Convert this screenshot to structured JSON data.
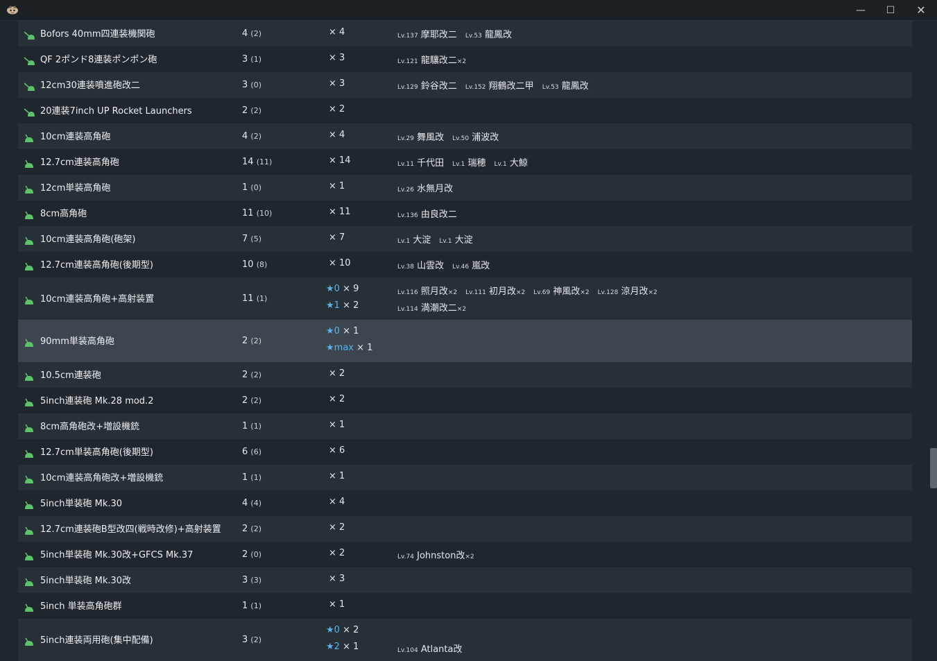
{
  "window": {
    "icon": "app-logo-icon",
    "minimize_glyph": "—",
    "maximize_glyph": "☐",
    "close_glyph": "✕"
  },
  "colors": {
    "star": "#5ab4ef",
    "icon_green": "#5cc36a",
    "row_alt": "#273036",
    "row_selected": "#3d464e"
  },
  "rows": [
    {
      "name": "Bofors 40mm四連装機関砲",
      "icon": "machine-gun-icon",
      "count": "4",
      "count_sub": "(2)",
      "mult": [
        "× 4"
      ],
      "ships": [
        [
          {
            "lv": "Lv.137",
            "name": "摩耶改二",
            "x": ""
          },
          {
            "lv": "Lv.53",
            "name": "龍鳳改",
            "x": ""
          }
        ]
      ]
    },
    {
      "name": "QF 2ポンド8連装ポンポン砲",
      "icon": "machine-gun-icon",
      "count": "3",
      "count_sub": "(1)",
      "mult": [
        "× 3"
      ],
      "ships": [
        [
          {
            "lv": "Lv.121",
            "name": "龍驤改二",
            "x": "×2"
          }
        ]
      ]
    },
    {
      "name": "12cm30連装噴進砲改二",
      "icon": "machine-gun-icon",
      "count": "3",
      "count_sub": "(0)",
      "mult": [
        "× 3"
      ],
      "ships": [
        [
          {
            "lv": "Lv.129",
            "name": "鈴谷改二",
            "x": ""
          },
          {
            "lv": "Lv.152",
            "name": "翔鶴改二甲",
            "x": ""
          },
          {
            "lv": "Lv.53",
            "name": "龍鳳改",
            "x": ""
          }
        ]
      ]
    },
    {
      "name": "20連装7inch UP Rocket Launchers",
      "icon": "machine-gun-icon",
      "count": "2",
      "count_sub": "(2)",
      "mult": [
        "× 2"
      ],
      "ships": []
    },
    {
      "name": "10cm連装高角砲",
      "icon": "aa-gun-icon",
      "count": "4",
      "count_sub": "(2)",
      "mult": [
        "× 4"
      ],
      "ships": [
        [
          {
            "lv": "Lv.29",
            "name": "舞風改",
            "x": ""
          },
          {
            "lv": "Lv.50",
            "name": "浦波改",
            "x": ""
          }
        ]
      ]
    },
    {
      "name": "12.7cm連装高角砲",
      "icon": "aa-gun-icon",
      "count": "14",
      "count_sub": "(11)",
      "mult": [
        "× 14"
      ],
      "ships": [
        [
          {
            "lv": "Lv.11",
            "name": "千代田",
            "x": ""
          },
          {
            "lv": "Lv.1",
            "name": "瑞穂",
            "x": ""
          },
          {
            "lv": "Lv.1",
            "name": "大鯨",
            "x": ""
          }
        ]
      ]
    },
    {
      "name": "12cm単装高角砲",
      "icon": "aa-gun-icon",
      "count": "1",
      "count_sub": "(0)",
      "mult": [
        "× 1"
      ],
      "ships": [
        [
          {
            "lv": "Lv.26",
            "name": "水無月改",
            "x": ""
          }
        ]
      ]
    },
    {
      "name": "8cm高角砲",
      "icon": "aa-gun-icon",
      "count": "11",
      "count_sub": "(10)",
      "mult": [
        "× 11"
      ],
      "ships": [
        [
          {
            "lv": "Lv.136",
            "name": "由良改二",
            "x": ""
          }
        ]
      ]
    },
    {
      "name": "10cm連装高角砲(砲架)",
      "icon": "aa-gun-icon",
      "count": "7",
      "count_sub": "(5)",
      "mult": [
        "× 7"
      ],
      "ships": [
        [
          {
            "lv": "Lv.1",
            "name": "大淀",
            "x": ""
          },
          {
            "lv": "Lv.1",
            "name": "大淀",
            "x": ""
          }
        ]
      ]
    },
    {
      "name": "12.7cm連装高角砲(後期型)",
      "icon": "aa-gun-icon",
      "count": "10",
      "count_sub": "(8)",
      "mult": [
        "× 10"
      ],
      "ships": [
        [
          {
            "lv": "Lv.38",
            "name": "山雲改",
            "x": ""
          },
          {
            "lv": "Lv.46",
            "name": "嵐改",
            "x": ""
          }
        ]
      ]
    },
    {
      "name": "10cm連装高角砲+高射装置",
      "icon": "aa-gun-icon",
      "count": "11",
      "count_sub": "(1)",
      "mult": [
        "★0|× 9",
        "★1|× 2"
      ],
      "ships": [
        [
          {
            "lv": "Lv.116",
            "name": "照月改",
            "x": "×2"
          },
          {
            "lv": "Lv.111",
            "name": "初月改",
            "x": "×2"
          },
          {
            "lv": "Lv.69",
            "name": "神風改",
            "x": "×2"
          },
          {
            "lv": "Lv.128",
            "name": "涼月改",
            "x": "×2"
          }
        ],
        [
          {
            "lv": "Lv.114",
            "name": "満潮改二",
            "x": "×2"
          }
        ]
      ]
    },
    {
      "name": "90mm単装高角砲",
      "icon": "aa-gun-icon",
      "count": "2",
      "count_sub": "(2)",
      "mult": [
        "★0|× 1",
        "★max|× 1"
      ],
      "ships": [],
      "selected": true
    },
    {
      "name": "10.5cm連装砲",
      "icon": "aa-gun-icon",
      "count": "2",
      "count_sub": "(2)",
      "mult": [
        "× 2"
      ],
      "ships": []
    },
    {
      "name": "5inch連装砲 Mk.28 mod.2",
      "icon": "aa-gun-icon",
      "count": "2",
      "count_sub": "(2)",
      "mult": [
        "× 2"
      ],
      "ships": []
    },
    {
      "name": "8cm高角砲改+増設機銃",
      "icon": "aa-gun-icon",
      "count": "1",
      "count_sub": "(1)",
      "mult": [
        "× 1"
      ],
      "ships": []
    },
    {
      "name": "12.7cm単装高角砲(後期型)",
      "icon": "aa-gun-icon",
      "count": "6",
      "count_sub": "(6)",
      "mult": [
        "× 6"
      ],
      "ships": []
    },
    {
      "name": "10cm連装高角砲改+増設機銃",
      "icon": "aa-gun-icon",
      "count": "1",
      "count_sub": "(1)",
      "mult": [
        "× 1"
      ],
      "ships": []
    },
    {
      "name": "5inch単装砲 Mk.30",
      "icon": "aa-gun-icon",
      "count": "4",
      "count_sub": "(4)",
      "mult": [
        "× 4"
      ],
      "ships": []
    },
    {
      "name": "12.7cm連装砲B型改四(戦時改修)+高射装置",
      "icon": "aa-gun-icon",
      "count": "2",
      "count_sub": "(2)",
      "mult": [
        "× 2"
      ],
      "ships": []
    },
    {
      "name": "5inch単装砲 Mk.30改+GFCS Mk.37",
      "icon": "aa-gun-icon",
      "count": "2",
      "count_sub": "(0)",
      "mult": [
        "× 2"
      ],
      "ships": [
        [
          {
            "lv": "Lv.74",
            "name": "Johnston改",
            "x": "×2"
          }
        ]
      ]
    },
    {
      "name": "5inch単装砲 Mk.30改",
      "icon": "aa-gun-icon",
      "count": "3",
      "count_sub": "(3)",
      "mult": [
        "× 3"
      ],
      "ships": []
    },
    {
      "name": "5inch 単装高角砲群",
      "icon": "aa-gun-icon",
      "count": "1",
      "count_sub": "(1)",
      "mult": [
        "× 1"
      ],
      "ships": []
    },
    {
      "name": "5inch連装両用砲(集中配備)",
      "icon": "aa-gun-icon",
      "count": "3",
      "count_sub": "(2)",
      "mult": [
        "★0|× 2",
        "★2|× 1"
      ],
      "ships": [
        [],
        [
          {
            "lv": "Lv.104",
            "name": "Atlanta改",
            "x": ""
          }
        ]
      ]
    }
  ]
}
